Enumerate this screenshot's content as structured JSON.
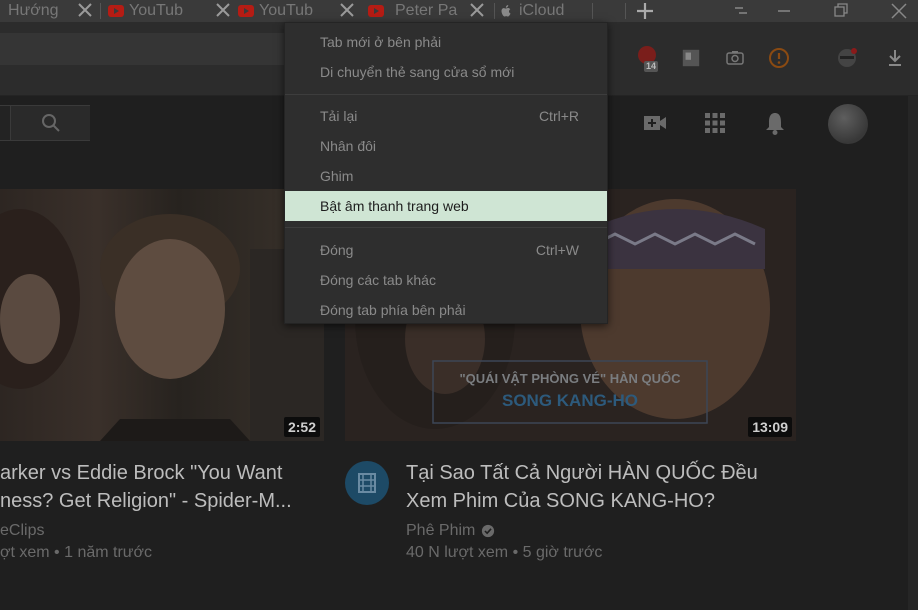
{
  "tabs": [
    {
      "title": "Hướng",
      "favicon": "tab-icon-generic"
    },
    {
      "title": "YouTub",
      "favicon": "youtube-icon"
    },
    {
      "title": "YouTub",
      "favicon": "youtube-icon"
    },
    {
      "title": "Peter Pa",
      "favicon": "youtube-icon"
    },
    {
      "title": "iCloud",
      "favicon": "apple-icon"
    }
  ],
  "toolbar": {
    "extension_badge": "14"
  },
  "context_menu": {
    "items": [
      {
        "label": "Tab mới ở bên phải",
        "shortcut": ""
      },
      {
        "label": "Di chuyển thẻ sang cửa sổ mới",
        "shortcut": ""
      },
      {
        "label": "Tải lại",
        "shortcut": "Ctrl+R"
      },
      {
        "label": "Nhân đôi",
        "shortcut": ""
      },
      {
        "label": "Ghim",
        "shortcut": ""
      },
      {
        "label": "Bật âm thanh trang web",
        "shortcut": ""
      },
      {
        "label": "Đóng",
        "shortcut": "Ctrl+W"
      },
      {
        "label": "Đóng các tab khác",
        "shortcut": ""
      },
      {
        "label": "Đóng tab phía bên phải",
        "shortcut": ""
      }
    ],
    "highlighted_index": 5
  },
  "videos": [
    {
      "duration": "2:52",
      "title_line1": "arker vs Eddie Brock \"You Want",
      "title_line2": "ness? Get Religion\" - Spider-M...",
      "channel": "eClips",
      "meta": "ợt xem • 1 năm trước"
    },
    {
      "duration": "13:09",
      "thumb_line1": "\"QUÁI VẬT PHÒNG VÉ\" HÀN QUỐC",
      "thumb_line2": "SONG KANG-HO",
      "title_line1": "Tại Sao Tất Cả Người HÀN QUỐC Đều",
      "title_line2": "Xem Phim Của SONG KANG-HO?",
      "channel": "Phê Phim",
      "meta": "40 N lượt xem • 5 giờ trước"
    }
  ],
  "colors": {
    "menu_highlight": "#cfe5d4",
    "youtube_red": "#b51c14"
  }
}
